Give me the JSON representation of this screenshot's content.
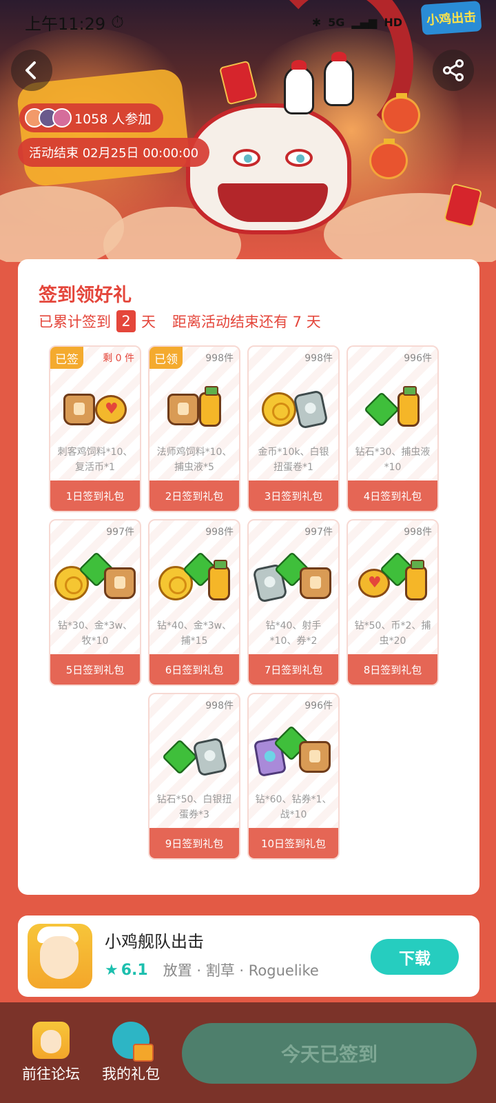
{
  "status_bar": {
    "time": "上午11:29",
    "network_label": "5G",
    "hd_label": "HD"
  },
  "banner": {
    "logo_text": "小鸡出击",
    "participants": "1058 人参加",
    "ends_at": "活动结束 02月25日 00:00:00"
  },
  "checkin": {
    "title": "签到领好礼",
    "summary_prefix": "已累计签到",
    "days_signed": "2",
    "days_unit": "天",
    "countdown": "距离活动结束还有 7 天",
    "cards": [
      {
        "badge": "已签",
        "stock": "剩 0 件",
        "desc": "刺客鸡饲料*10、复活币*1",
        "label": "1日签到礼包"
      },
      {
        "badge": "已领",
        "stock": "998件",
        "desc": "法师鸡饲料*10、捕虫液*5",
        "label": "2日签到礼包"
      },
      {
        "badge": "",
        "stock": "998件",
        "desc": "金币*10k、白银扭蛋卷*1",
        "label": "3日签到礼包"
      },
      {
        "badge": "",
        "stock": "996件",
        "desc": "钻石*30、捕虫液*10",
        "label": "4日签到礼包"
      },
      {
        "badge": "",
        "stock": "997件",
        "desc": "钻*30、金*3w、牧*10",
        "label": "5日签到礼包"
      },
      {
        "badge": "",
        "stock": "998件",
        "desc": "钻*40、金*3w、捕*15",
        "label": "6日签到礼包"
      },
      {
        "badge": "",
        "stock": "997件",
        "desc": "钻*40、射手*10、券*2",
        "label": "7日签到礼包"
      },
      {
        "badge": "",
        "stock": "998件",
        "desc": "钻*50、币*2、捕虫*20",
        "label": "8日签到礼包"
      },
      {
        "badge": "",
        "stock": "998件",
        "desc": "钻石*50、白银扭蛋券*3",
        "label": "9日签到礼包"
      },
      {
        "badge": "",
        "stock": "996件",
        "desc": "钻*60、钻券*1、战*10",
        "label": "10日签到礼包"
      }
    ]
  },
  "game": {
    "name": "小鸡舰队出击",
    "rating": "6.1",
    "tags": "放置 · 割草 · Roguelike",
    "download": "下载"
  },
  "bottom_bar": {
    "forum": "前往论坛",
    "gifts": "我的礼包",
    "checkin_button": "今天已签到"
  },
  "colors": {
    "accent": "#e4463b",
    "page_bg": "#e35a45",
    "download": "#26cdbf",
    "bottom_bar": "#7b3329"
  }
}
